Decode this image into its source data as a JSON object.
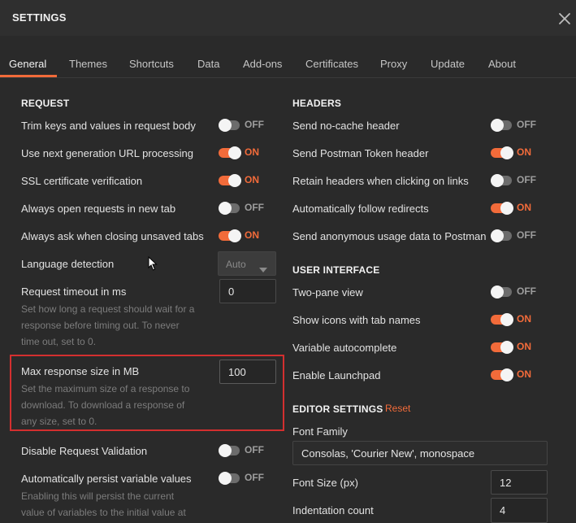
{
  "header": {
    "title": "SETTINGS"
  },
  "tabs": [
    "General",
    "Themes",
    "Shortcuts",
    "Data",
    "Add-ons",
    "Certificates",
    "Proxy",
    "Update",
    "About"
  ],
  "request": {
    "title": "REQUEST",
    "trim": {
      "label": "Trim keys and values in request body",
      "state": "OFF"
    },
    "url": {
      "label": "Use next generation URL processing",
      "state": "ON"
    },
    "ssl": {
      "label": "SSL certificate verification",
      "state": "ON"
    },
    "newtab": {
      "label": "Always open requests in new tab",
      "state": "OFF"
    },
    "askclose": {
      "label": "Always ask when closing unsaved tabs",
      "state": "ON"
    },
    "language": {
      "label": "Language detection",
      "value": "Auto"
    },
    "timeout": {
      "label": "Request timeout in ms",
      "value": "0",
      "help_line1": "Set how long a request should wait for a",
      "help_line2": "response before timing out. To never",
      "help_line3": "time out, set to 0."
    },
    "maxsize": {
      "label": "Max response size in MB",
      "value": "100",
      "help_line1": "Set the maximum size of a response to",
      "help_line2": "download. To download a response of",
      "help_line3": "any size, set to 0."
    },
    "validation": {
      "label": "Disable Request Validation",
      "state": "OFF"
    },
    "persist": {
      "label": "Automatically persist variable values",
      "state": "OFF",
      "help_line1": "Enabling this will persist the current",
      "help_line2": "value of variables to the initial value at"
    }
  },
  "headers": {
    "title": "HEADERS",
    "nocache": {
      "label": "Send no-cache header",
      "state": "OFF"
    },
    "token": {
      "label": "Send Postman Token header",
      "state": "ON"
    },
    "retain": {
      "label": "Retain headers when clicking on links",
      "state": "OFF"
    },
    "redirects": {
      "label": "Automatically follow redirects",
      "state": "ON"
    },
    "anon": {
      "label": "Send anonymous usage data to Postman",
      "state": "OFF"
    }
  },
  "ui": {
    "title": "USER INTERFACE",
    "twopane": {
      "label": "Two-pane view",
      "state": "OFF"
    },
    "icons": {
      "label": "Show icons with tab names",
      "state": "ON"
    },
    "autocomplete": {
      "label": "Variable autocomplete",
      "state": "ON"
    },
    "launchpad": {
      "label": "Enable Launchpad",
      "state": "ON"
    }
  },
  "editor": {
    "title": "EDITOR SETTINGS",
    "reset": "Reset",
    "font_family": {
      "label": "Font Family",
      "value": "Consolas, 'Courier New', monospace"
    },
    "font_size": {
      "label": "Font Size (px)",
      "value": "12"
    },
    "indentation": {
      "label": "Indentation count",
      "value": "4"
    }
  },
  "colors": {
    "accent": "#f26b3a",
    "highlight": "#d32f2f"
  }
}
